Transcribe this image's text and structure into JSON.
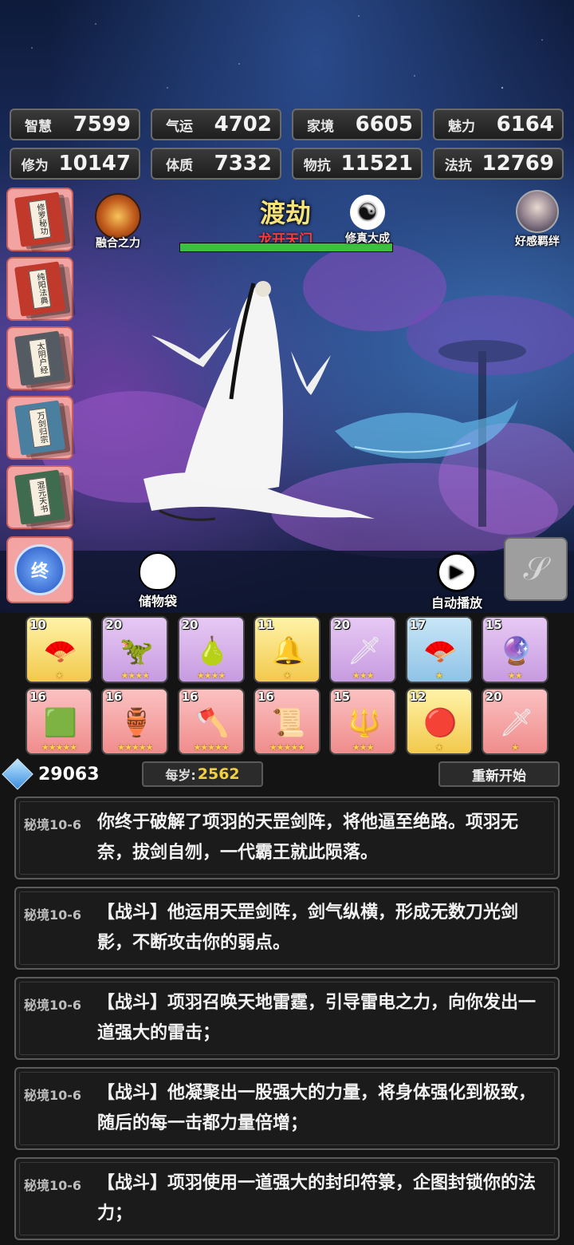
{
  "stats": [
    {
      "label": "智慧",
      "value": "7599"
    },
    {
      "label": "气运",
      "value": "4702"
    },
    {
      "label": "家境",
      "value": "6605"
    },
    {
      "label": "魅力",
      "value": "6164"
    },
    {
      "label": "修为",
      "value": "10147"
    },
    {
      "label": "体质",
      "value": "7332"
    },
    {
      "label": "物抗",
      "value": "11521"
    },
    {
      "label": "法抗",
      "value": "12769"
    }
  ],
  "books": [
    {
      "title": "修罗秘功",
      "color": "#c0392b"
    },
    {
      "title": "纯阳法典",
      "color": "#c0392b"
    },
    {
      "title": "太阴户经",
      "color": "#555b63"
    },
    {
      "title": "万剑归宗",
      "color": "#4a7fa0"
    },
    {
      "title": "混元天书",
      "color": "#3f6b4f"
    }
  ],
  "top": {
    "fusion_label": "融合之力",
    "stage_title": "渡劫",
    "stage_sub": "龙开天门",
    "stage_progress": 1.0,
    "cultivation_label": "修真大成",
    "affinity_label": "好感羁绊"
  },
  "actions": {
    "end_label": "终",
    "bag_label": "储物袋",
    "autoplay_label": "自动播放"
  },
  "items": [
    {
      "level": "10",
      "stars": 1,
      "quality": "gold",
      "icon": "fan-icon"
    },
    {
      "level": "20",
      "stars": 4,
      "quality": "purple",
      "icon": "green-claw-icon"
    },
    {
      "level": "20",
      "stars": 4,
      "quality": "purple",
      "icon": "gourd-icon"
    },
    {
      "level": "11",
      "stars": 1,
      "quality": "gold",
      "icon": "golden-bell-icon"
    },
    {
      "level": "20",
      "stars": 3,
      "quality": "purple",
      "icon": "sword-icon"
    },
    {
      "level": "17",
      "stars": 1,
      "quality": "blue",
      "icon": "folding-fan-icon"
    },
    {
      "level": "15",
      "stars": 2,
      "quality": "purple",
      "icon": "orb-icon"
    },
    {
      "level": "16",
      "stars": 5,
      "quality": "red",
      "icon": "jade-seal-icon"
    },
    {
      "level": "16",
      "stars": 5,
      "quality": "red",
      "icon": "cauldron-icon"
    },
    {
      "level": "16",
      "stars": 5,
      "quality": "red",
      "icon": "axe-icon"
    },
    {
      "level": "16",
      "stars": 5,
      "quality": "red",
      "icon": "scroll-icon"
    },
    {
      "level": "15",
      "stars": 3,
      "quality": "red",
      "icon": "halberd-icon"
    },
    {
      "level": "12",
      "stars": 1,
      "quality": "gold",
      "icon": "red-pearl-icon"
    },
    {
      "level": "20",
      "stars": 1,
      "quality": "red",
      "icon": "spear-icon"
    }
  ],
  "bar": {
    "crystals": "29063",
    "per_age_label": "每岁:",
    "per_age_value": "2562",
    "restart_label": "重新开始"
  },
  "logs": [
    {
      "src": "秘境10-6",
      "text": "你终于破解了项羽的天罡剑阵，将他逼至绝路。项羽无奈，拔剑自刎，一代霸王就此陨落。"
    },
    {
      "src": "秘境10-6",
      "text": "【战斗】他运用天罡剑阵，剑气纵横，形成无数刀光剑影，不断攻击你的弱点。"
    },
    {
      "src": "秘境10-6",
      "text": "【战斗】项羽召唤天地雷霆，引导雷电之力，向你发出一道强大的雷击；"
    },
    {
      "src": "秘境10-6",
      "text": "【战斗】他凝聚出一股强大的力量，将身体强化到极致，随后的每一击都力量倍增；"
    },
    {
      "src": "秘境10-6",
      "text": "【战斗】项羽使用一道强大的封印符箓，企图封锁你的法力；"
    }
  ]
}
